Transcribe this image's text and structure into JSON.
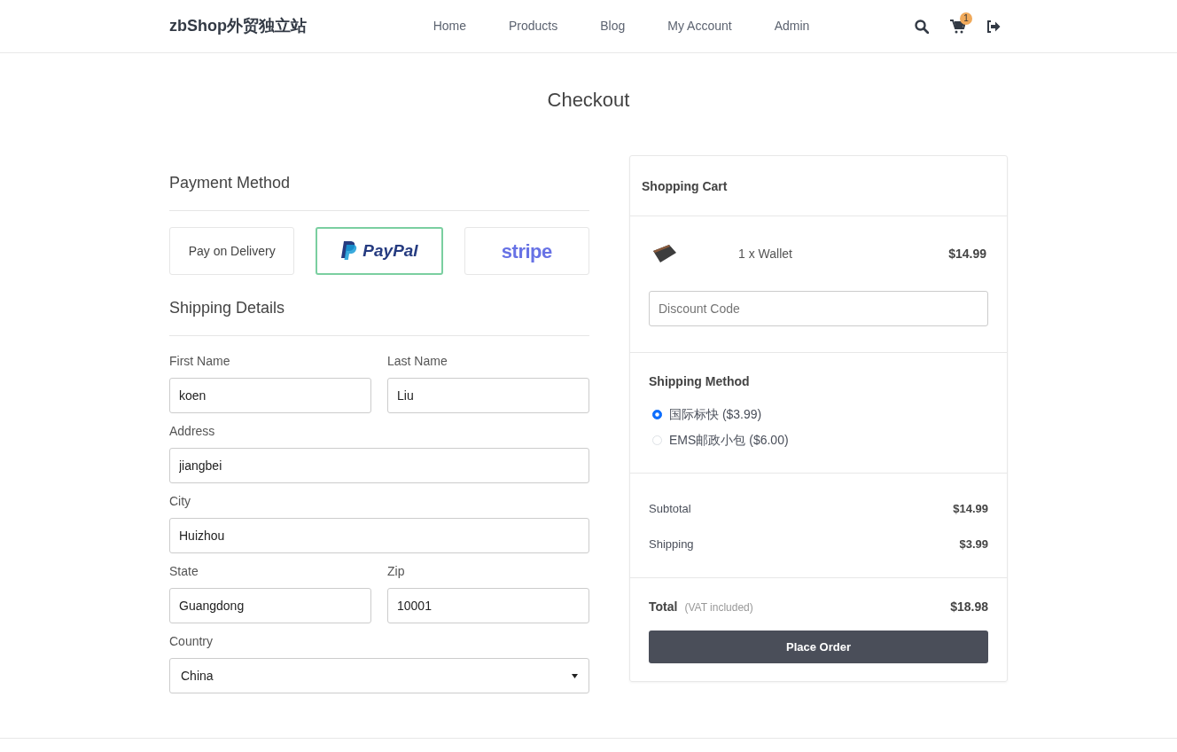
{
  "brand": "zbShop外贸独立站",
  "nav": [
    {
      "label": "Home"
    },
    {
      "label": "Products"
    },
    {
      "label": "Blog"
    },
    {
      "label": "My Account"
    },
    {
      "label": "Admin"
    }
  ],
  "cart_count": "1",
  "title": "Checkout",
  "payment": {
    "heading": "Payment Method",
    "options": [
      {
        "kind": "text",
        "label": "Pay on Delivery",
        "selected": false
      },
      {
        "kind": "paypal",
        "label": "PayPal",
        "selected": true
      },
      {
        "kind": "stripe",
        "label": "stripe",
        "selected": false
      }
    ]
  },
  "shipping": {
    "heading": "Shipping Details",
    "rows": [
      [
        {
          "label": "First Name",
          "value": "koen",
          "kind": "input"
        },
        {
          "label": "Last Name",
          "value": "Liu",
          "kind": "input"
        }
      ],
      [
        {
          "label": "Address",
          "value": "jiangbei",
          "kind": "input"
        }
      ],
      [
        {
          "label": "City",
          "value": "Huizhou",
          "kind": "input"
        }
      ],
      [
        {
          "label": "State",
          "value": "Guangdong",
          "kind": "input"
        },
        {
          "label": "Zip",
          "value": "10001",
          "kind": "input"
        }
      ],
      [
        {
          "label": "Country",
          "value": "China",
          "kind": "select"
        }
      ]
    ]
  },
  "cart": {
    "heading": "Shopping Cart",
    "items": [
      {
        "name": "1 x Wallet",
        "price": "$14.99"
      }
    ],
    "discount": {
      "placeholder": "Discount Code"
    },
    "shipping_method": {
      "heading": "Shipping Method",
      "options": [
        {
          "label": "国际标快 ($3.99)",
          "selected": true
        },
        {
          "label": "EMS邮政小包 ($6.00)",
          "selected": false
        }
      ]
    },
    "summary": [
      {
        "label": "Subtotal",
        "value": "$14.99"
      },
      {
        "label": "Shipping",
        "value": "$3.99"
      }
    ],
    "total": {
      "label": "Total",
      "note": "(VAT included)",
      "value": "$18.98"
    },
    "button": "Place Order"
  }
}
